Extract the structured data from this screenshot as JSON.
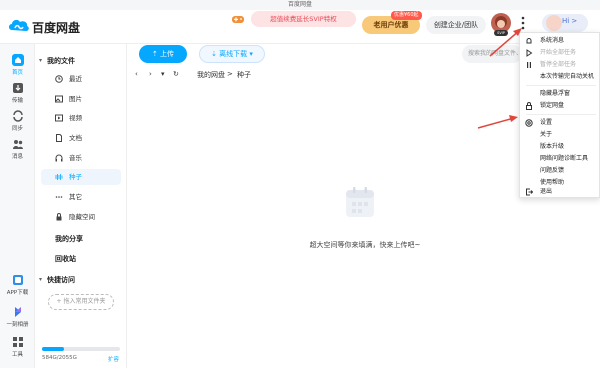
{
  "window_title": "百度网盘",
  "header": {
    "brand": "百度网盘",
    "promo": "超值续费延长SVIP特权",
    "vip_button": "老用户优惠",
    "vip_tag": "优惠¥60起",
    "enterprise_button": "创建企业/团队",
    "avatar_tag": "SVIP",
    "hi": "Hi >"
  },
  "nav": [
    {
      "label": "首页"
    },
    {
      "label": "传输"
    },
    {
      "label": "同步"
    },
    {
      "label": "消息"
    },
    {
      "label": "APP下载"
    },
    {
      "label": "一刻相册"
    },
    {
      "label": "工具"
    }
  ],
  "sidebar": {
    "my_files": "我的文件",
    "items": [
      {
        "label": "最近",
        "icon": "clock-icon"
      },
      {
        "label": "图片",
        "icon": "image-icon"
      },
      {
        "label": "视频",
        "icon": "video-icon"
      },
      {
        "label": "文档",
        "icon": "document-icon"
      },
      {
        "label": "音乐",
        "icon": "headphones-icon"
      },
      {
        "label": "种子",
        "icon": "torrent-icon"
      },
      {
        "label": "其它",
        "icon": "more-dots-icon"
      },
      {
        "label": "隐藏空间",
        "icon": "lock-icon"
      }
    ],
    "my_share": "我的分享",
    "recycle": "回收站",
    "quick_access": "快捷访问",
    "quick_add": "+ 拖入常用文件夹",
    "storage": {
      "text": "584G/2055G",
      "used_fraction": 0.284
    },
    "expand": "扩容"
  },
  "toolbar": {
    "upload": "上传",
    "offline": "离线下载 ▾",
    "search_placeholder": "搜索我的网盘文件、会员权益"
  },
  "breadcrumb": {
    "root": "我的网盘",
    "sep": ">",
    "current": "种子"
  },
  "empty": {
    "text": "超大空间等你来填满，快来上传吧~"
  },
  "menu": {
    "items": [
      {
        "label": "系统消息",
        "disabled": false,
        "icon": "bell-icon"
      },
      {
        "label": "开始全部任务",
        "disabled": true,
        "icon": "play-icon"
      },
      {
        "label": "暂停全部任务",
        "disabled": true,
        "icon": "pause-icon"
      },
      {
        "label": "本次传输完自动关机",
        "disabled": false,
        "icon": ""
      },
      {
        "label": "隐藏悬浮窗",
        "disabled": false,
        "icon": ""
      },
      {
        "label": "锁定网盘",
        "disabled": false,
        "icon": "lock-icon"
      },
      {
        "label": "设置",
        "disabled": false,
        "icon": "settings-icon"
      },
      {
        "label": "关于",
        "disabled": false,
        "icon": ""
      },
      {
        "label": "版本升级",
        "disabled": false,
        "icon": ""
      },
      {
        "label": "网络问题诊断工具",
        "disabled": false,
        "icon": ""
      },
      {
        "label": "问题反馈",
        "disabled": false,
        "icon": ""
      },
      {
        "label": "使用帮助",
        "disabled": false,
        "icon": ""
      },
      {
        "label": "退出",
        "disabled": false,
        "icon": "exit-icon"
      }
    ]
  },
  "colors": {
    "accent": "#06a7ff",
    "annotation_arrow": "#e0463c"
  }
}
